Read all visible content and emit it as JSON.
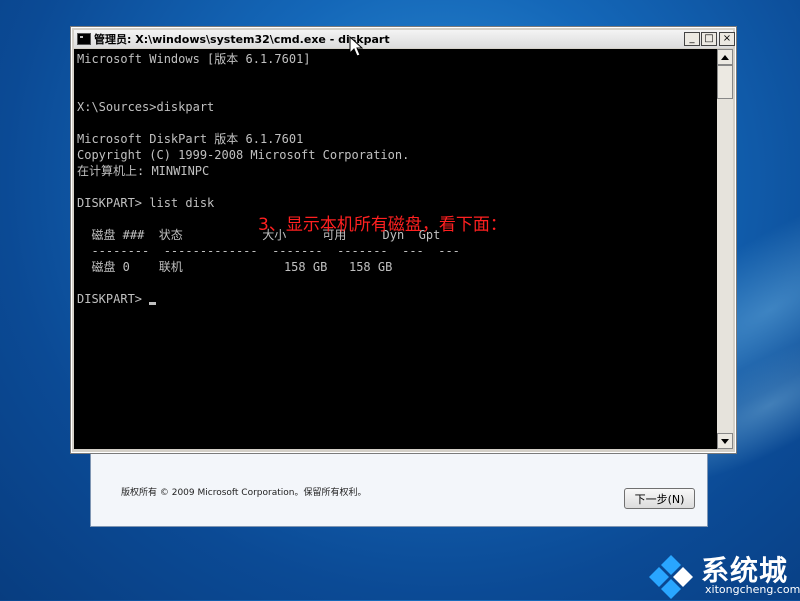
{
  "window": {
    "title": "管理员: X:\\windows\\system32\\cmd.exe - diskpart",
    "minimize_label": "_",
    "maximize_label": "□",
    "close_label": "×"
  },
  "console_lines": [
    "Microsoft Windows [版本 6.1.7601]",
    "",
    "",
    "X:\\Sources>diskpart",
    "",
    "Microsoft DiskPart 版本 6.1.7601",
    "Copyright (C) 1999-2008 Microsoft Corporation.",
    "在计算机上: MINWINPC",
    "",
    "DISKPART> list disk",
    "",
    "  磁盘 ###  状态           大小     可用     Dyn  Gpt",
    "  --------  -------------  -------  -------  ---  ---",
    "  磁盘 0    联机              158 GB   158 GB",
    "",
    "DISKPART> "
  ],
  "annotation": "3、显示本机所有磁盘，看下面：",
  "setup_dialog": {
    "copyright": "版权所有 © 2009 Microsoft Corporation。保留所有权利。",
    "next_button": "下一步(N)"
  },
  "watermark": {
    "name": "系统城",
    "url": "xitongcheng.com"
  },
  "icons": [
    "console-icon",
    "scroll-up-arrow-icon",
    "scroll-down-arrow-icon",
    "mouse-pointer-icon",
    "watermark-logo-icon"
  ],
  "colors": {
    "console_bg": "#000000",
    "console_text": "#c0c0c0",
    "annotation": "#ff2020",
    "desktop": "#1467b8"
  }
}
